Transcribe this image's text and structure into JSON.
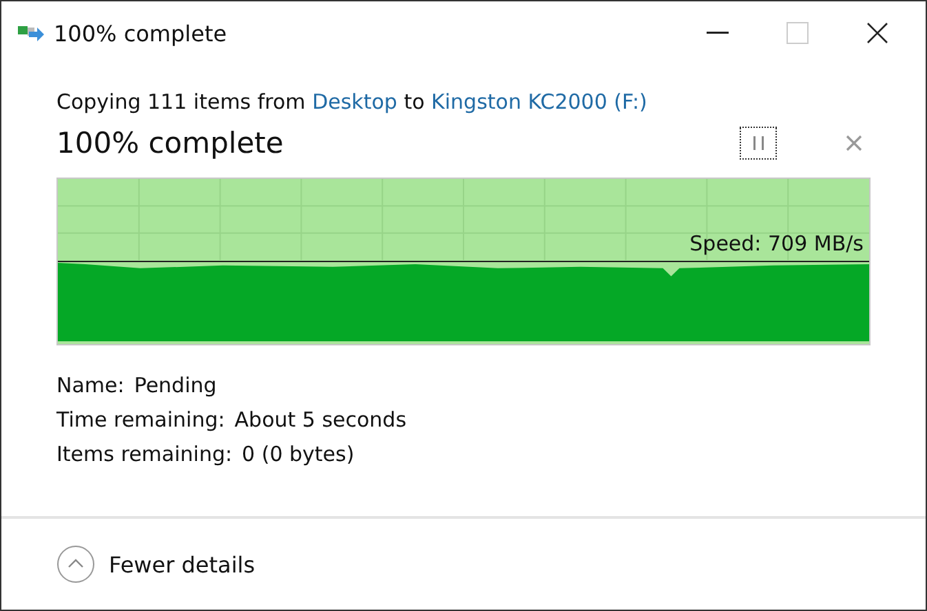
{
  "window": {
    "title": "100% complete"
  },
  "summary": [
    {
      "kind": "text",
      "text": "Copying 111 items from "
    },
    {
      "kind": "link",
      "text": "Desktop"
    },
    {
      "kind": "text",
      "text": " to "
    },
    {
      "kind": "link",
      "text": "Kingston KC2000 (F:)"
    }
  ],
  "progress_title": "100% complete",
  "graph": {
    "level": 1,
    "speed": "Speed: 709 MB/s"
  },
  "details": [
    {
      "label": "Name:",
      "value": "Pending"
    },
    {
      "label": "Time remaining:",
      "value": "About 5 seconds"
    },
    {
      "label": "Items remaining:",
      "value": "0 (0 bytes)"
    }
  ],
  "footer": {
    "label": "Fewer details",
    "expanded": true
  }
}
